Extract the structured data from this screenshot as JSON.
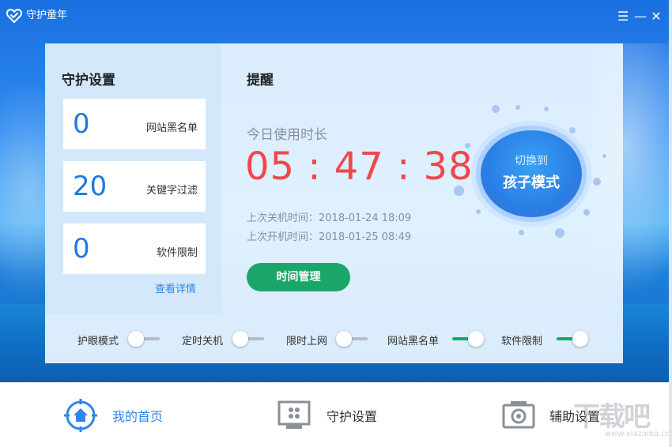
{
  "titlebar": {
    "app_title": "守护童年",
    "menu_glyph": "☰",
    "minimize_glyph": "—",
    "close_glyph": "✕"
  },
  "left_panel": {
    "title": "守护设置",
    "stats": [
      {
        "value": "0",
        "label": "网站黑名单"
      },
      {
        "value": "20",
        "label": "关键字过滤"
      },
      {
        "value": "0",
        "label": "软件限制"
      }
    ],
    "details_link": "查看详情"
  },
  "right_panel": {
    "title": "提醒",
    "usage_label": "今日使用时长",
    "usage_time": "05 : 47 : 38",
    "last_shutdown": "上次关机时间：2018-01-24  18:09",
    "last_boot": "上次开机时间：2018-01-25  08:49",
    "time_mgmt_button": "时间管理",
    "mode_button": {
      "line1": "切换到",
      "line2": "孩子模式"
    }
  },
  "toggles": [
    {
      "label": "护眼模式",
      "on": false
    },
    {
      "label": "定时关机",
      "on": false
    },
    {
      "label": "限时上网",
      "on": false
    },
    {
      "label": "网站黑名单",
      "on": true
    },
    {
      "label": "软件限制",
      "on": true
    }
  ],
  "bottom_nav": [
    {
      "label": "我的首页",
      "icon": "home-icon",
      "active": true
    },
    {
      "label": "守护设置",
      "icon": "monitor-icon",
      "active": false
    },
    {
      "label": "辅助设置",
      "icon": "gear-icon",
      "active": false
    }
  ],
  "watermark": {
    "text": "下载吧",
    "sub": "www.xiazaiba.com"
  },
  "colors": {
    "accent_blue": "#2f86e8",
    "timer_red": "#f0474d",
    "toggle_green": "#1aa66a"
  }
}
